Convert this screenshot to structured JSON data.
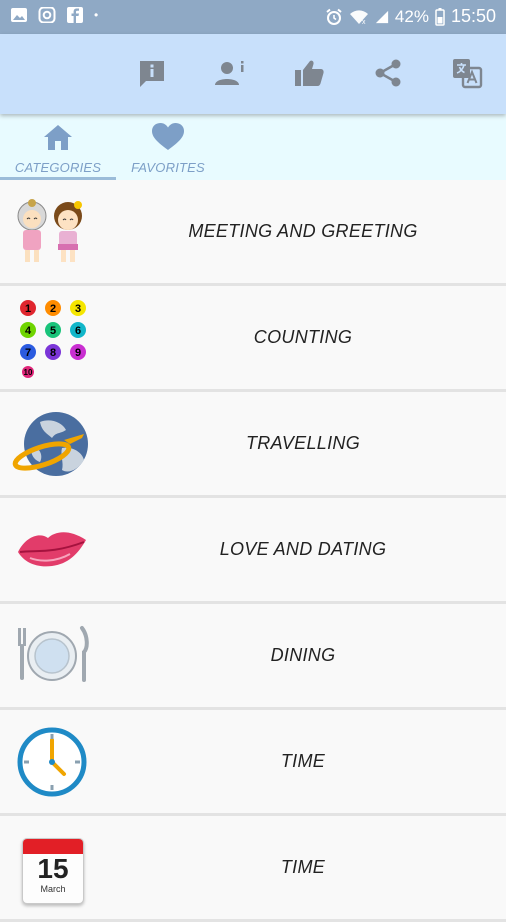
{
  "status_bar": {
    "battery": "42%",
    "time": "15:50",
    "dot": "•"
  },
  "tabs": [
    {
      "label": "CATEGORIES",
      "active": true,
      "icon": "home-icon"
    },
    {
      "label": "FAVORITES",
      "active": false,
      "icon": "heart-icon"
    }
  ],
  "app_bar": {
    "actions": [
      "info-icon",
      "person-info-icon",
      "thumbs-up-icon",
      "share-icon",
      "translate-icon"
    ]
  },
  "calendar": {
    "day": "15",
    "month": "March"
  },
  "categories": [
    {
      "label": "MEETING AND GREETING",
      "icon": "greeting-kids-icon"
    },
    {
      "label": "COUNTING",
      "icon": "counting-numbers-icon"
    },
    {
      "label": "TRAVELLING",
      "icon": "globe-plane-icon"
    },
    {
      "label": "LOVE AND DATING",
      "icon": "lips-kiss-icon"
    },
    {
      "label": "DINING",
      "icon": "plate-cutlery-icon"
    },
    {
      "label": "TIME",
      "icon": "clock-icon"
    },
    {
      "label": "TIME",
      "icon": "calendar-icon"
    }
  ],
  "colors": {
    "status_bar": "#8fa9c5",
    "app_bar": "#c8e0fb",
    "tab_bar": "#e8fbff",
    "tab_text": "#7d9fc7",
    "icon_gray": "#7e8690"
  }
}
